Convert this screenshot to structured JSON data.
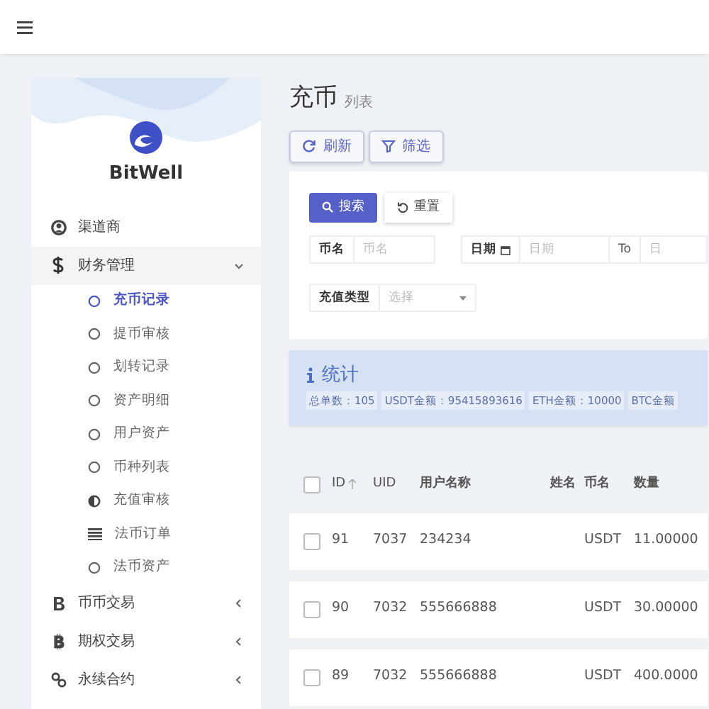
{
  "sidebar": {
    "brand": "BitWell",
    "items": [
      {
        "label": "渠道商",
        "kind": "link",
        "selected": false
      },
      {
        "label": "财务管理",
        "kind": "group",
        "expanded": true,
        "children": [
          {
            "label": "充币记录",
            "selected": true
          },
          {
            "label": "提币审核",
            "selected": false
          },
          {
            "label": "划转记录",
            "selected": false
          },
          {
            "label": "资产明细",
            "selected": false
          },
          {
            "label": "用户资产",
            "selected": false
          },
          {
            "label": "币种列表",
            "selected": false
          },
          {
            "label": "充值审核",
            "selected": false
          },
          {
            "label": "法币订单",
            "selected": false
          },
          {
            "label": "法币资产",
            "selected": false
          }
        ]
      },
      {
        "label": "币币交易",
        "kind": "group",
        "expanded": false
      },
      {
        "label": "期权交易",
        "kind": "group",
        "expanded": false
      },
      {
        "label": "永续合约",
        "kind": "group",
        "expanded": false
      }
    ]
  },
  "header": {
    "title": "充币",
    "subtitle": "列表"
  },
  "toolbar": [
    "刷新",
    "筛选"
  ],
  "filter": {
    "search_button": "搜索",
    "reset_button": "重置",
    "fields": [
      {
        "label": "币名",
        "placeholder": "币名",
        "kind": "text"
      },
      {
        "label": "日期",
        "placeholder": "日期",
        "kind": "date",
        "to_label": "To",
        "to_placeholder": "日"
      },
      {
        "label": "充值类型",
        "placeholder": "选择",
        "kind": "select"
      }
    ]
  },
  "stats": {
    "title": "统计",
    "items": [
      "总单数：105",
      "USDT金额：95415893616",
      "ETH金额：10000",
      "BTC金额"
    ]
  },
  "table": {
    "all_checked": false,
    "columns": [
      {
        "label": "ID",
        "sorted": true
      },
      {
        "label": "UID",
        "sorted": false
      },
      {
        "label": "用户名称",
        "sorted": false
      },
      {
        "label": "姓名",
        "sorted": false
      },
      {
        "label": "币名",
        "sorted": false
      },
      {
        "label": "数量",
        "sorted": false
      }
    ],
    "rows": [
      {
        "checked": false,
        "cells": [
          "91",
          "7037",
          "234234",
          "",
          "USDT",
          "11.00000"
        ]
      },
      {
        "checked": false,
        "cells": [
          "90",
          "7032",
          "555666888",
          "",
          "USDT",
          "30.00000"
        ]
      },
      {
        "checked": false,
        "cells": [
          "89",
          "7032",
          "555666888",
          "",
          "USDT",
          "400.0000"
        ]
      }
    ]
  }
}
